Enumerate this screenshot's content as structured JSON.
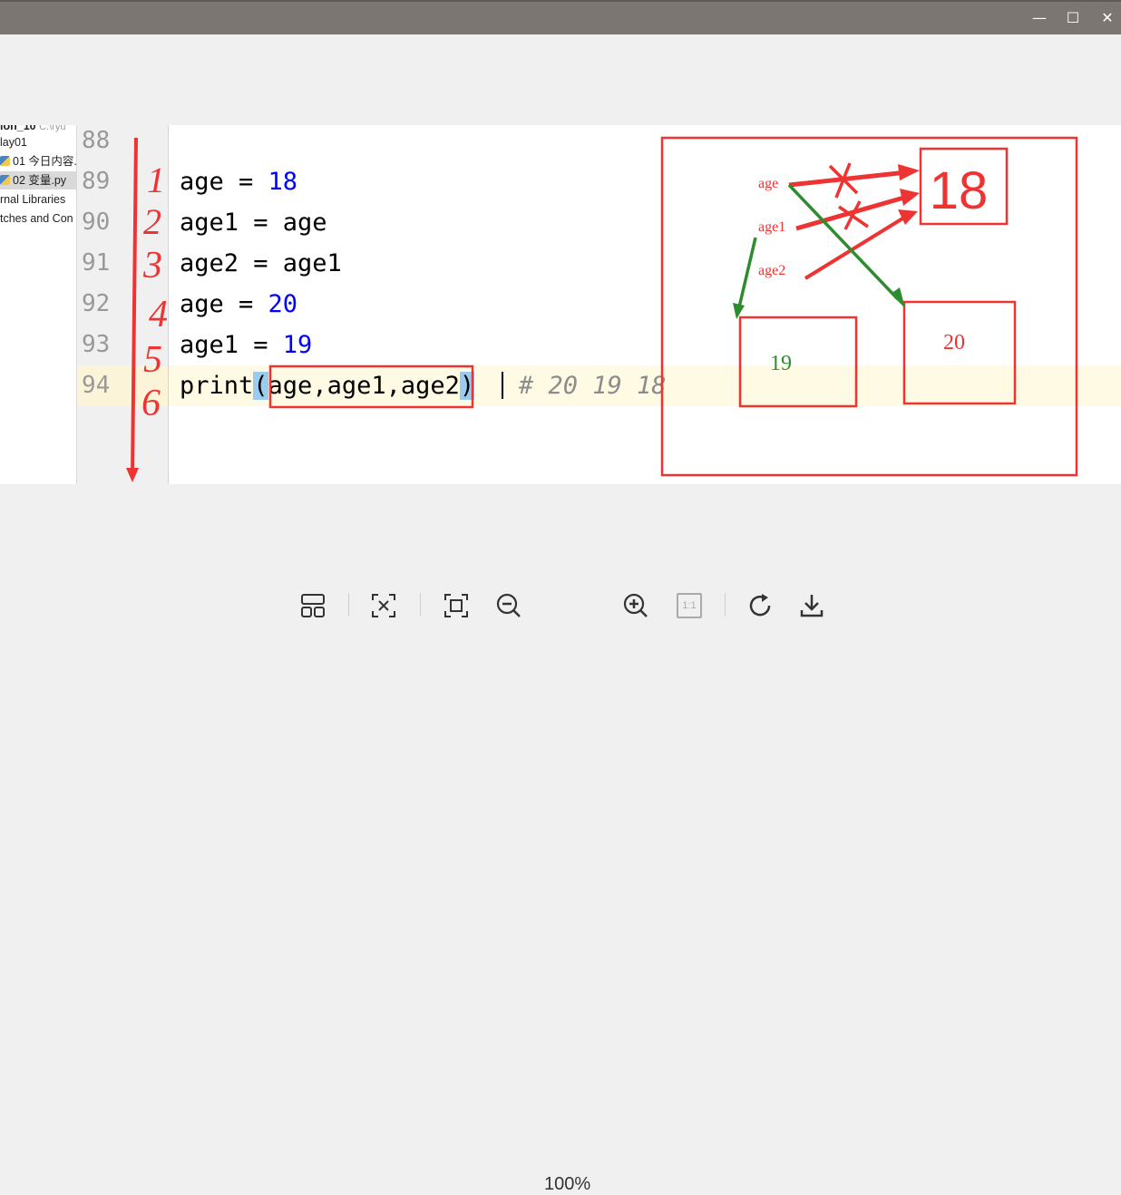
{
  "window": {
    "minimize_glyph": "—",
    "maximize_glyph": "☐",
    "close_glyph": "✕"
  },
  "project_tree": {
    "items": [
      {
        "label": "ion_10",
        "hint": "C:\\ryu",
        "selected": false
      },
      {
        "label": "lay01",
        "selected": false
      },
      {
        "label": "01 今日内容.",
        "icon": "python-file-icon",
        "selected": false
      },
      {
        "label": "02 变量.py",
        "icon": "python-file-icon",
        "selected": true
      },
      {
        "label": "rnal Libraries",
        "selected": false
      },
      {
        "label": "tches and Con",
        "selected": false
      }
    ]
  },
  "editor": {
    "line_numbers": [
      "88",
      "89",
      "90",
      "91",
      "92",
      "93",
      "94"
    ],
    "current_line": "94",
    "lines": [
      {
        "ln": "88",
        "text": ""
      },
      {
        "ln": "89",
        "pre": "age = ",
        "num": "18"
      },
      {
        "ln": "90",
        "pre": "age1 = age"
      },
      {
        "ln": "91",
        "pre": "age2 = age1"
      },
      {
        "ln": "92",
        "pre": "age = ",
        "num": "20"
      },
      {
        "ln": "93",
        "pre": "age1 = ",
        "num": "19"
      },
      {
        "ln": "94",
        "fn": "print",
        "open": "(",
        "args": "age,age1,age2",
        "close": ")",
        "comment": "# 20 19 18"
      }
    ]
  },
  "annotations": {
    "step_numbers": [
      "1",
      "2",
      "3",
      "4",
      "5",
      "6"
    ],
    "diagram": {
      "var_labels": [
        "age",
        "age1",
        "age2"
      ],
      "values": [
        "18",
        "19",
        "20"
      ],
      "crossed_marks": 2,
      "colors": {
        "red": "#ee3333",
        "green": "#2e8b2e"
      }
    }
  },
  "toolbar": {
    "zoom_level": "100%",
    "icons": [
      "layout-icon",
      "fit-icon",
      "fullscreen-icon",
      "zoom-out-icon",
      "zoom-in-icon",
      "actual-size-icon",
      "rotate-icon",
      "download-icon"
    ],
    "actual_size_label": "1:1"
  }
}
